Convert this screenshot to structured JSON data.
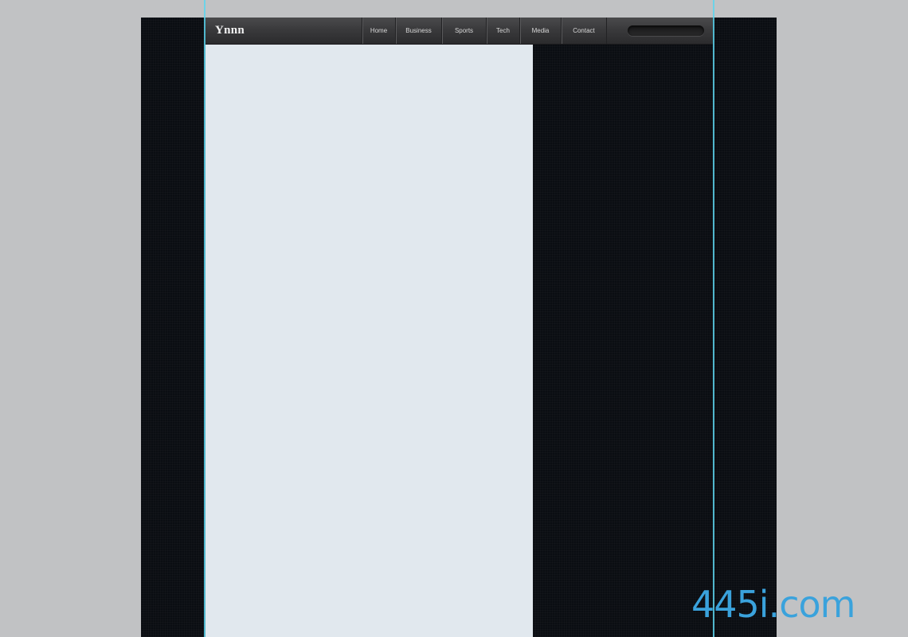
{
  "header": {
    "logo_text": "Ynnn",
    "nav_items": [
      "Home",
      "Business",
      "Sports",
      "Tech",
      "Media",
      "Contact"
    ],
    "search": {
      "placeholder": ""
    }
  },
  "watermark": {
    "text": "445i.com"
  },
  "colors": {
    "page_background": "#c1c2c4",
    "canvas_background": "#0a0d12",
    "header_bar": "#3a3a3c",
    "content_panel": "#e1e8ee",
    "guide_line": "#5dd6ee",
    "watermark": "#3aa2dc"
  }
}
